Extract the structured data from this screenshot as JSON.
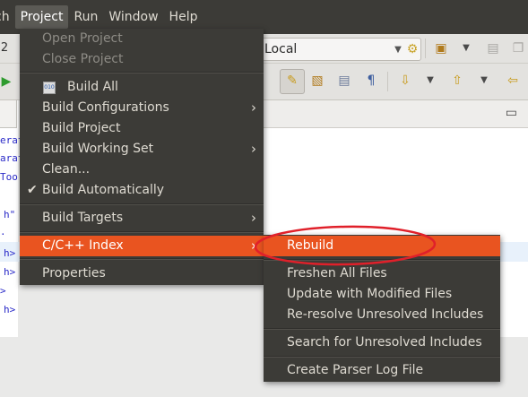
{
  "menubar": {
    "items": [
      {
        "label": "ch"
      },
      {
        "label": "Project"
      },
      {
        "label": "Run"
      },
      {
        "label": "Window"
      },
      {
        "label": "Help"
      }
    ]
  },
  "toolbar": {
    "partial_left": "2",
    "launch_target_value": "Local",
    "icons": [
      "new-icon",
      "save-icon",
      "copy-icon",
      "run-icon",
      "highlight-icon",
      "format-icon",
      "outline-icon",
      "pilcrow-icon",
      "next-annotation-icon",
      "prev-annotation-icon",
      "back-icon"
    ]
  },
  "editor": {
    "lines": [
      {
        "text": "erat"
      },
      {
        "text": "arat"
      },
      {
        "text": "Too"
      },
      {
        "text": "h\""
      },
      {
        "text": "."
      },
      {
        "text": "h>"
      },
      {
        "text": "h>"
      },
      {
        "text": ">"
      },
      {
        "text": "h>"
      }
    ]
  },
  "project_menu": {
    "items": [
      {
        "label": "Open Project",
        "disabled": true
      },
      {
        "label": "Close Project",
        "disabled": true
      },
      {
        "label": "Build All"
      },
      {
        "label": "Build Configurations"
      },
      {
        "label": "Build Project"
      },
      {
        "label": "Build Working Set"
      },
      {
        "label": "Clean..."
      },
      {
        "label": "Build Automatically",
        "checked": true
      },
      {
        "label": "Build Targets"
      },
      {
        "label": "C/C++ Index",
        "highlighted": true
      },
      {
        "label": "Properties"
      }
    ]
  },
  "index_submenu": {
    "items": [
      {
        "label": "Rebuild",
        "highlighted": true
      },
      {
        "label": "Freshen All Files"
      },
      {
        "label": "Update with Modified Files"
      },
      {
        "label": "Re-resolve Unresolved Includes"
      },
      {
        "label": "Search for Unresolved Includes"
      },
      {
        "label": "Create Parser Log File"
      }
    ]
  },
  "colors": {
    "menu_bg": "#3c3b37",
    "menu_text": "#dfdbd2",
    "highlight": "#e95420",
    "annotation": "#e0202a"
  }
}
